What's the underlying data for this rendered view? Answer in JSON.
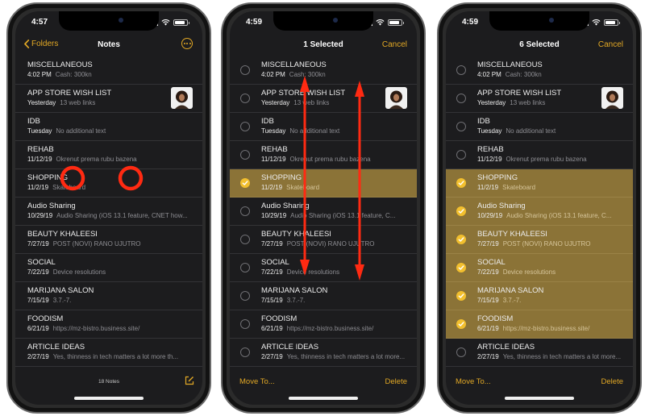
{
  "phones": [
    {
      "status_time": "4:57",
      "back_label": "Folders",
      "title": "Notes",
      "notes_count": "18 Notes",
      "notes": [
        {
          "title": "MISCELLANEOUS",
          "date": "4:02 PM",
          "snippet": "Cash: 300kn",
          "thumb": false,
          "selected": false
        },
        {
          "title": "APP STORE WISH LIST",
          "date": "Yesterday",
          "snippet": "13 web links",
          "thumb": true,
          "selected": false
        },
        {
          "title": "IDB",
          "date": "Tuesday",
          "snippet": "No additional text",
          "thumb": false,
          "selected": false
        },
        {
          "title": "REHAB",
          "date": "11/12/19",
          "snippet": "Okrenut prema rubu bazena",
          "thumb": false,
          "selected": false
        },
        {
          "title": "SHOPPING",
          "date": "11/2/19",
          "snippet": "Skateboard",
          "thumb": false,
          "selected": false
        },
        {
          "title": "Audio Sharing",
          "date": "10/29/19",
          "snippet": "Audio Sharing (iOS 13.1 feature, CNET how...",
          "thumb": false,
          "selected": false
        },
        {
          "title": "BEAUTY KHALEESI",
          "date": "7/27/19",
          "snippet": "POST (NOVI) RANO UJUTRO",
          "thumb": false,
          "selected": false
        },
        {
          "title": "SOCIAL",
          "date": "7/22/19",
          "snippet": "Device resolutions",
          "thumb": false,
          "selected": false
        },
        {
          "title": "MARIJANA SALON",
          "date": "7/15/19",
          "snippet": "3.7.-7.",
          "thumb": false,
          "selected": false
        },
        {
          "title": "FOODISM",
          "date": "6/21/19",
          "snippet": "https://mz-bistro.business.site/",
          "thumb": false,
          "selected": false
        },
        {
          "title": "ARTICLE IDEAS",
          "date": "2/27/19",
          "snippet": "Yes, thinness in tech matters a lot more th...",
          "thumb": false,
          "selected": false
        }
      ]
    },
    {
      "status_time": "4:59",
      "title": "1 Selected",
      "right_label": "Cancel",
      "move_label": "Move To...",
      "delete_label": "Delete",
      "notes": [
        {
          "title": "MISCELLANEOUS",
          "date": "4:02 PM",
          "snippet": "Cash: 300kn",
          "thumb": false,
          "selected": false
        },
        {
          "title": "APP STORE WISH LIST",
          "date": "Yesterday",
          "snippet": "13 web links",
          "thumb": true,
          "selected": false
        },
        {
          "title": "IDB",
          "date": "Tuesday",
          "snippet": "No additional text",
          "thumb": false,
          "selected": false
        },
        {
          "title": "REHAB",
          "date": "11/12/19",
          "snippet": "Okrenut prema rubu bazena",
          "thumb": false,
          "selected": false
        },
        {
          "title": "SHOPPING",
          "date": "11/2/19",
          "snippet": "Skateboard",
          "thumb": false,
          "selected": true
        },
        {
          "title": "Audio Sharing",
          "date": "10/29/19",
          "snippet": "Audio Sharing (iOS 13.1 feature, C...",
          "thumb": false,
          "selected": false
        },
        {
          "title": "BEAUTY KHALEESI",
          "date": "7/27/19",
          "snippet": "POST (NOVI) RANO UJUTRO",
          "thumb": false,
          "selected": false
        },
        {
          "title": "SOCIAL",
          "date": "7/22/19",
          "snippet": "Device resolutions",
          "thumb": false,
          "selected": false
        },
        {
          "title": "MARIJANA SALON",
          "date": "7/15/19",
          "snippet": "3.7.-7.",
          "thumb": false,
          "selected": false
        },
        {
          "title": "FOODISM",
          "date": "6/21/19",
          "snippet": "https://mz-bistro.business.site/",
          "thumb": false,
          "selected": false
        },
        {
          "title": "ARTICLE IDEAS",
          "date": "2/27/19",
          "snippet": "Yes, thinness in tech matters a lot more...",
          "thumb": false,
          "selected": false
        }
      ]
    },
    {
      "status_time": "4:59",
      "title": "6 Selected",
      "right_label": "Cancel",
      "move_label": "Move To...",
      "delete_label": "Delete",
      "notes": [
        {
          "title": "MISCELLANEOUS",
          "date": "4:02 PM",
          "snippet": "Cash: 300kn",
          "thumb": false,
          "selected": false
        },
        {
          "title": "APP STORE WISH LIST",
          "date": "Yesterday",
          "snippet": "13 web links",
          "thumb": true,
          "selected": false
        },
        {
          "title": "IDB",
          "date": "Tuesday",
          "snippet": "No additional text",
          "thumb": false,
          "selected": false
        },
        {
          "title": "REHAB",
          "date": "11/12/19",
          "snippet": "Okrenut prema rubu bazena",
          "thumb": false,
          "selected": false
        },
        {
          "title": "SHOPPING",
          "date": "11/2/19",
          "snippet": "Skateboard",
          "thumb": false,
          "selected": true
        },
        {
          "title": "Audio Sharing",
          "date": "10/29/19",
          "snippet": "Audio Sharing (iOS 13.1 feature, C...",
          "thumb": false,
          "selected": true
        },
        {
          "title": "BEAUTY KHALEESI",
          "date": "7/27/19",
          "snippet": "POST (NOVI) RANO UJUTRO",
          "thumb": false,
          "selected": true
        },
        {
          "title": "SOCIAL",
          "date": "7/22/19",
          "snippet": "Device resolutions",
          "thumb": false,
          "selected": true
        },
        {
          "title": "MARIJANA SALON",
          "date": "7/15/19",
          "snippet": "3.7.-7.",
          "thumb": false,
          "selected": true
        },
        {
          "title": "FOODISM",
          "date": "6/21/19",
          "snippet": "https://mz-bistro.business.site/",
          "thumb": false,
          "selected": true
        },
        {
          "title": "ARTICLE IDEAS",
          "date": "2/27/19",
          "snippet": "Yes, thinness in tech matters a lot more...",
          "thumb": false,
          "selected": false
        }
      ]
    }
  ],
  "colors": {
    "accent": "#e2a825",
    "selected_row": "#8b7337",
    "checkmark": "#f2bf2e",
    "annotation": "#ff2a12",
    "background": "#1c1c1e"
  },
  "icons": [
    "chevron-left-icon",
    "more-icon",
    "compose-icon",
    "check-icon",
    "signal-icon",
    "wifi-icon",
    "battery-icon"
  ]
}
